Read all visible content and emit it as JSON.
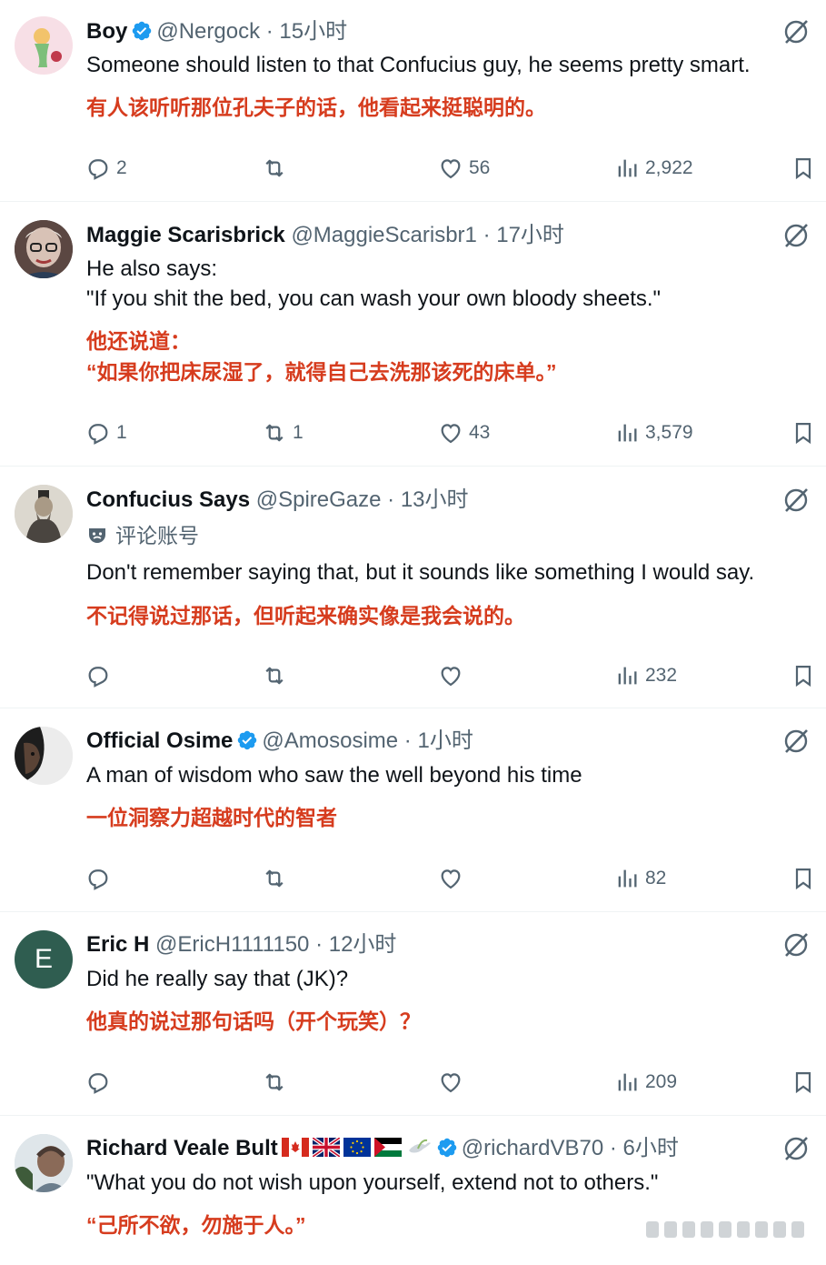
{
  "tweets": [
    {
      "name": "Boy",
      "handle": "@Nergock",
      "time": "15小时",
      "verified": true,
      "text_lines": [
        "Someone should listen to that Confucius guy, he seems pretty smart."
      ],
      "translation_lines": [
        "有人该听听那位孔夫子的话，他看起来挺聪明的。"
      ],
      "replies": "2",
      "reposts": "",
      "likes": "56",
      "views": "2,922"
    },
    {
      "name": "Maggie Scarisbrick",
      "handle": "@MaggieScarisbr1",
      "time": "17小时",
      "verified": false,
      "text_lines": [
        "He also says:",
        "\"If you shit the bed, you can wash your own bloody sheets.\""
      ],
      "translation_lines": [
        "他还说道：",
        "“如果你把床尿湿了，就得自己去洗那该死的床单。”"
      ],
      "replies": "1",
      "reposts": "1",
      "likes": "43",
      "views": "3,579"
    },
    {
      "name": "Confucius Says",
      "handle": "@SpireGaze",
      "time": "13小时",
      "verified": false,
      "badge": "评论账号",
      "text_lines": [
        "Don't remember saying that, but it sounds like something I would say."
      ],
      "translation_lines": [
        "不记得说过那话，但听起来确实像是我会说的。"
      ],
      "replies": "",
      "reposts": "",
      "likes": "",
      "views": "232"
    },
    {
      "name": "Official Osime",
      "handle": "@Amososime",
      "time": "1小时",
      "verified": true,
      "text_lines": [
        "A man of wisdom who saw the well beyond his time"
      ],
      "translation_lines": [
        "一位洞察力超越时代的智者"
      ],
      "replies": "",
      "reposts": "",
      "likes": "",
      "views": "82"
    },
    {
      "name": "Eric H",
      "handle": "@EricH1111150",
      "time": "12小时",
      "verified": false,
      "avatar_letter": "E",
      "text_lines": [
        "Did he really say that (JK)?"
      ],
      "translation_lines": [
        "他真的说过那句话吗（开个玩笑）？"
      ],
      "replies": "",
      "reposts": "",
      "likes": "",
      "views": "209"
    },
    {
      "name": "Richard Veale Bult",
      "handle": "@richardVB70",
      "time": "6小时",
      "verified": true,
      "text_lines": [
        "\"What you do not wish upon yourself, extend not to others.\""
      ],
      "translation_lines": [
        "“己所不欲，勿施于人。”"
      ]
    }
  ],
  "separator": "·",
  "colors": {
    "verified": "#1d9bf0",
    "translation": "#d63c1e",
    "secondary": "#536471",
    "eric_avatar": "#2f5d50"
  }
}
